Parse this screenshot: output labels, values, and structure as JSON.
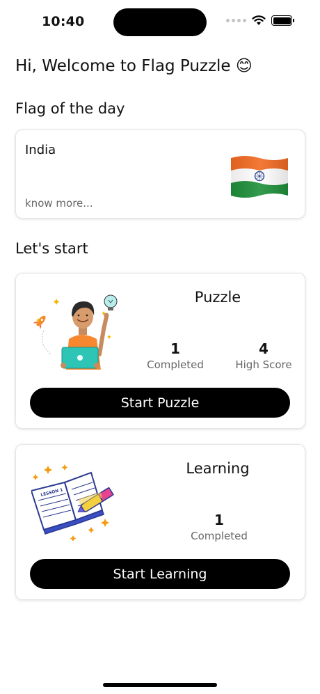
{
  "status_bar": {
    "time": "10:40"
  },
  "welcome": {
    "text": "Hi, Welcome to Flag Puzzle 😊"
  },
  "flag_of_the_day": {
    "heading": "Flag of the day",
    "country": "India",
    "know_more": "know more..."
  },
  "lets_start": {
    "heading": "Let's start"
  },
  "puzzle": {
    "title": "Puzzle",
    "completed_value": "1",
    "completed_label": "Completed",
    "high_score_value": "4",
    "high_score_label": "High Score",
    "button_label": "Start Puzzle",
    "illustration": "person-laptop-idea-illustration"
  },
  "learning": {
    "title": "Learning",
    "completed_value": "1",
    "completed_label": "Completed",
    "button_label": "Start Learning",
    "illustration": "open-book-lesson-illustration",
    "book_text": "LESSON 1"
  },
  "colors": {
    "button_bg": "#000000",
    "button_text": "#ffffff",
    "muted_text": "#666666",
    "saffron": "#FF6A1A",
    "green": "#138808",
    "chakra": "#1E3A8A"
  }
}
